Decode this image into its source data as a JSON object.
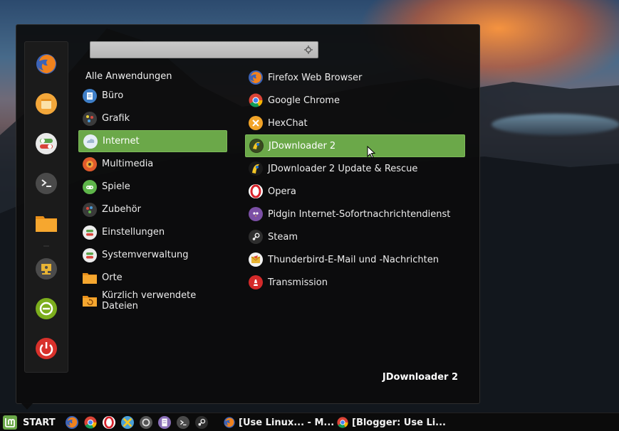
{
  "menu": {
    "search": {
      "value": "",
      "placeholder": ""
    },
    "favorites": [
      {
        "name": "Firefox",
        "icon": "firefox-icon"
      },
      {
        "name": "Notes",
        "icon": "notes-icon"
      },
      {
        "name": "Settings",
        "icon": "settings-toggle-icon"
      },
      {
        "name": "Terminal",
        "icon": "terminal-icon"
      },
      {
        "name": "Files",
        "icon": "folder-icon"
      },
      {
        "name": "Lock screen",
        "icon": "lock-screen-icon"
      },
      {
        "name": "Log out",
        "icon": "logout-icon"
      },
      {
        "name": "Shut down",
        "icon": "power-icon"
      }
    ],
    "categories": {
      "header": "Alle Anwendungen",
      "items": [
        {
          "label": "Büro",
          "icon": "office-icon"
        },
        {
          "label": "Grafik",
          "icon": "graphics-icon"
        },
        {
          "label": "Internet",
          "icon": "internet-icon",
          "active": true
        },
        {
          "label": "Multimedia",
          "icon": "multimedia-icon"
        },
        {
          "label": "Spiele",
          "icon": "games-icon"
        },
        {
          "label": "Zubehör",
          "icon": "accessories-icon"
        },
        {
          "label": "Einstellungen",
          "icon": "settings-icon"
        },
        {
          "label": "Systemverwaltung",
          "icon": "administration-icon"
        },
        {
          "label": "Orte",
          "icon": "places-folder-icon"
        },
        {
          "label": "Kürzlich verwendete Dateien",
          "icon": "recent-files-icon"
        }
      ]
    },
    "apps": [
      {
        "label": "Firefox Web Browser",
        "icon": "firefox-icon"
      },
      {
        "label": "Google Chrome",
        "icon": "chrome-icon"
      },
      {
        "label": "HexChat",
        "icon": "hexchat-icon"
      },
      {
        "label": "JDownloader 2",
        "icon": "jdownloader-icon",
        "active": true
      },
      {
        "label": "JDownloader 2 Update & Rescue",
        "icon": "jdownloader-rescue-icon"
      },
      {
        "label": "Opera",
        "icon": "opera-icon"
      },
      {
        "label": "Pidgin Internet-Sofortnachrichtendienst",
        "icon": "pidgin-icon"
      },
      {
        "label": "Steam",
        "icon": "steam-icon"
      },
      {
        "label": "Thunderbird-E-Mail und -Nachrichten",
        "icon": "thunderbird-icon"
      },
      {
        "label": "Transmission",
        "icon": "transmission-icon"
      }
    ],
    "selected_app_name": "JDownloader 2"
  },
  "taskbar": {
    "start_label": "START",
    "launchers": [
      "firefox-icon",
      "chrome-icon",
      "opera-icon",
      "xchat-icon",
      "steam-circle-icon",
      "text-editor-icon",
      "terminal-icon",
      "steam-icon"
    ],
    "windows": [
      {
        "label": "[Use Linux... - M...",
        "icon": "firefox-icon"
      },
      {
        "label": "[Blogger: Use Li...",
        "icon": "chrome-icon"
      }
    ]
  },
  "colors": {
    "accent": "#6ba849",
    "menu_background": "#0c0c0c",
    "search_background": "#c2c2c2",
    "taskbar_background": "#0b0b0b"
  }
}
